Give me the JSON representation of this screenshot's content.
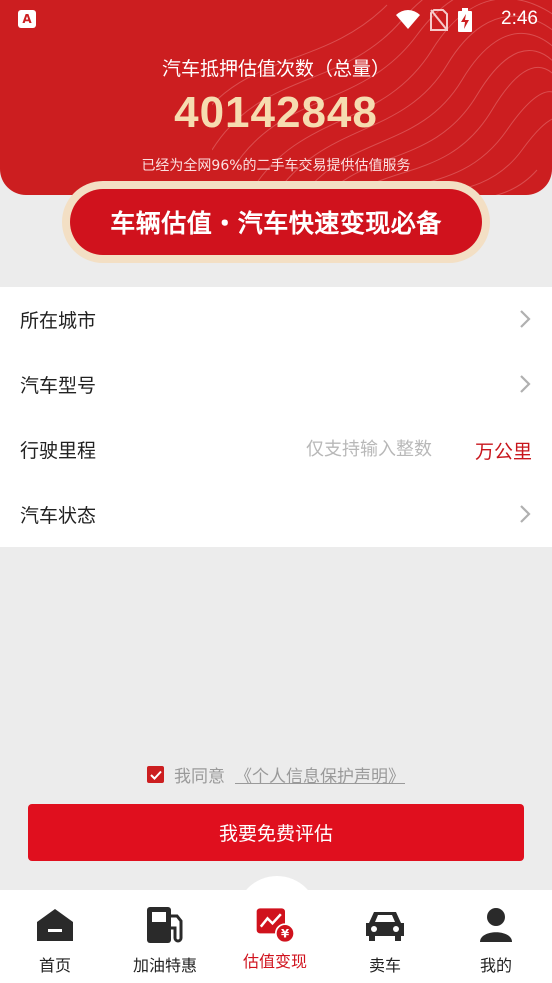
{
  "status_bar": {
    "time": "2:46",
    "app_badge": "A"
  },
  "header": {
    "title": "汽车抵押估值次数（总量）",
    "count": "40142848",
    "subtitle": "已经为全网96%的二手车交易提供估值服务"
  },
  "banner": {
    "text": "车辆估值・汽车快速变现必备"
  },
  "form": {
    "city_label": "所在城市",
    "model_label": "汽车型号",
    "mileage_label": "行驶里程",
    "mileage_placeholder": "仅支持输入整数",
    "mileage_unit": "万公里",
    "condition_label": "汽车状态"
  },
  "agreement": {
    "prefix": "我同意",
    "link": "《个人信息保护声明》",
    "checked": true
  },
  "submit_label": "我要免费评估",
  "bottom_nav": {
    "items": [
      {
        "label": "首页",
        "icon": "home-icon"
      },
      {
        "label": "加油特惠",
        "icon": "fuel-icon"
      },
      {
        "label": "估值变现",
        "icon": "valuation-icon",
        "active": true
      },
      {
        "label": "卖车",
        "icon": "car-icon"
      },
      {
        "label": "我的",
        "icon": "profile-icon"
      }
    ]
  },
  "colors": {
    "brand_red": "#cc1e20",
    "accent_gold": "#f6dcb0",
    "button_red": "#e00f1e"
  }
}
